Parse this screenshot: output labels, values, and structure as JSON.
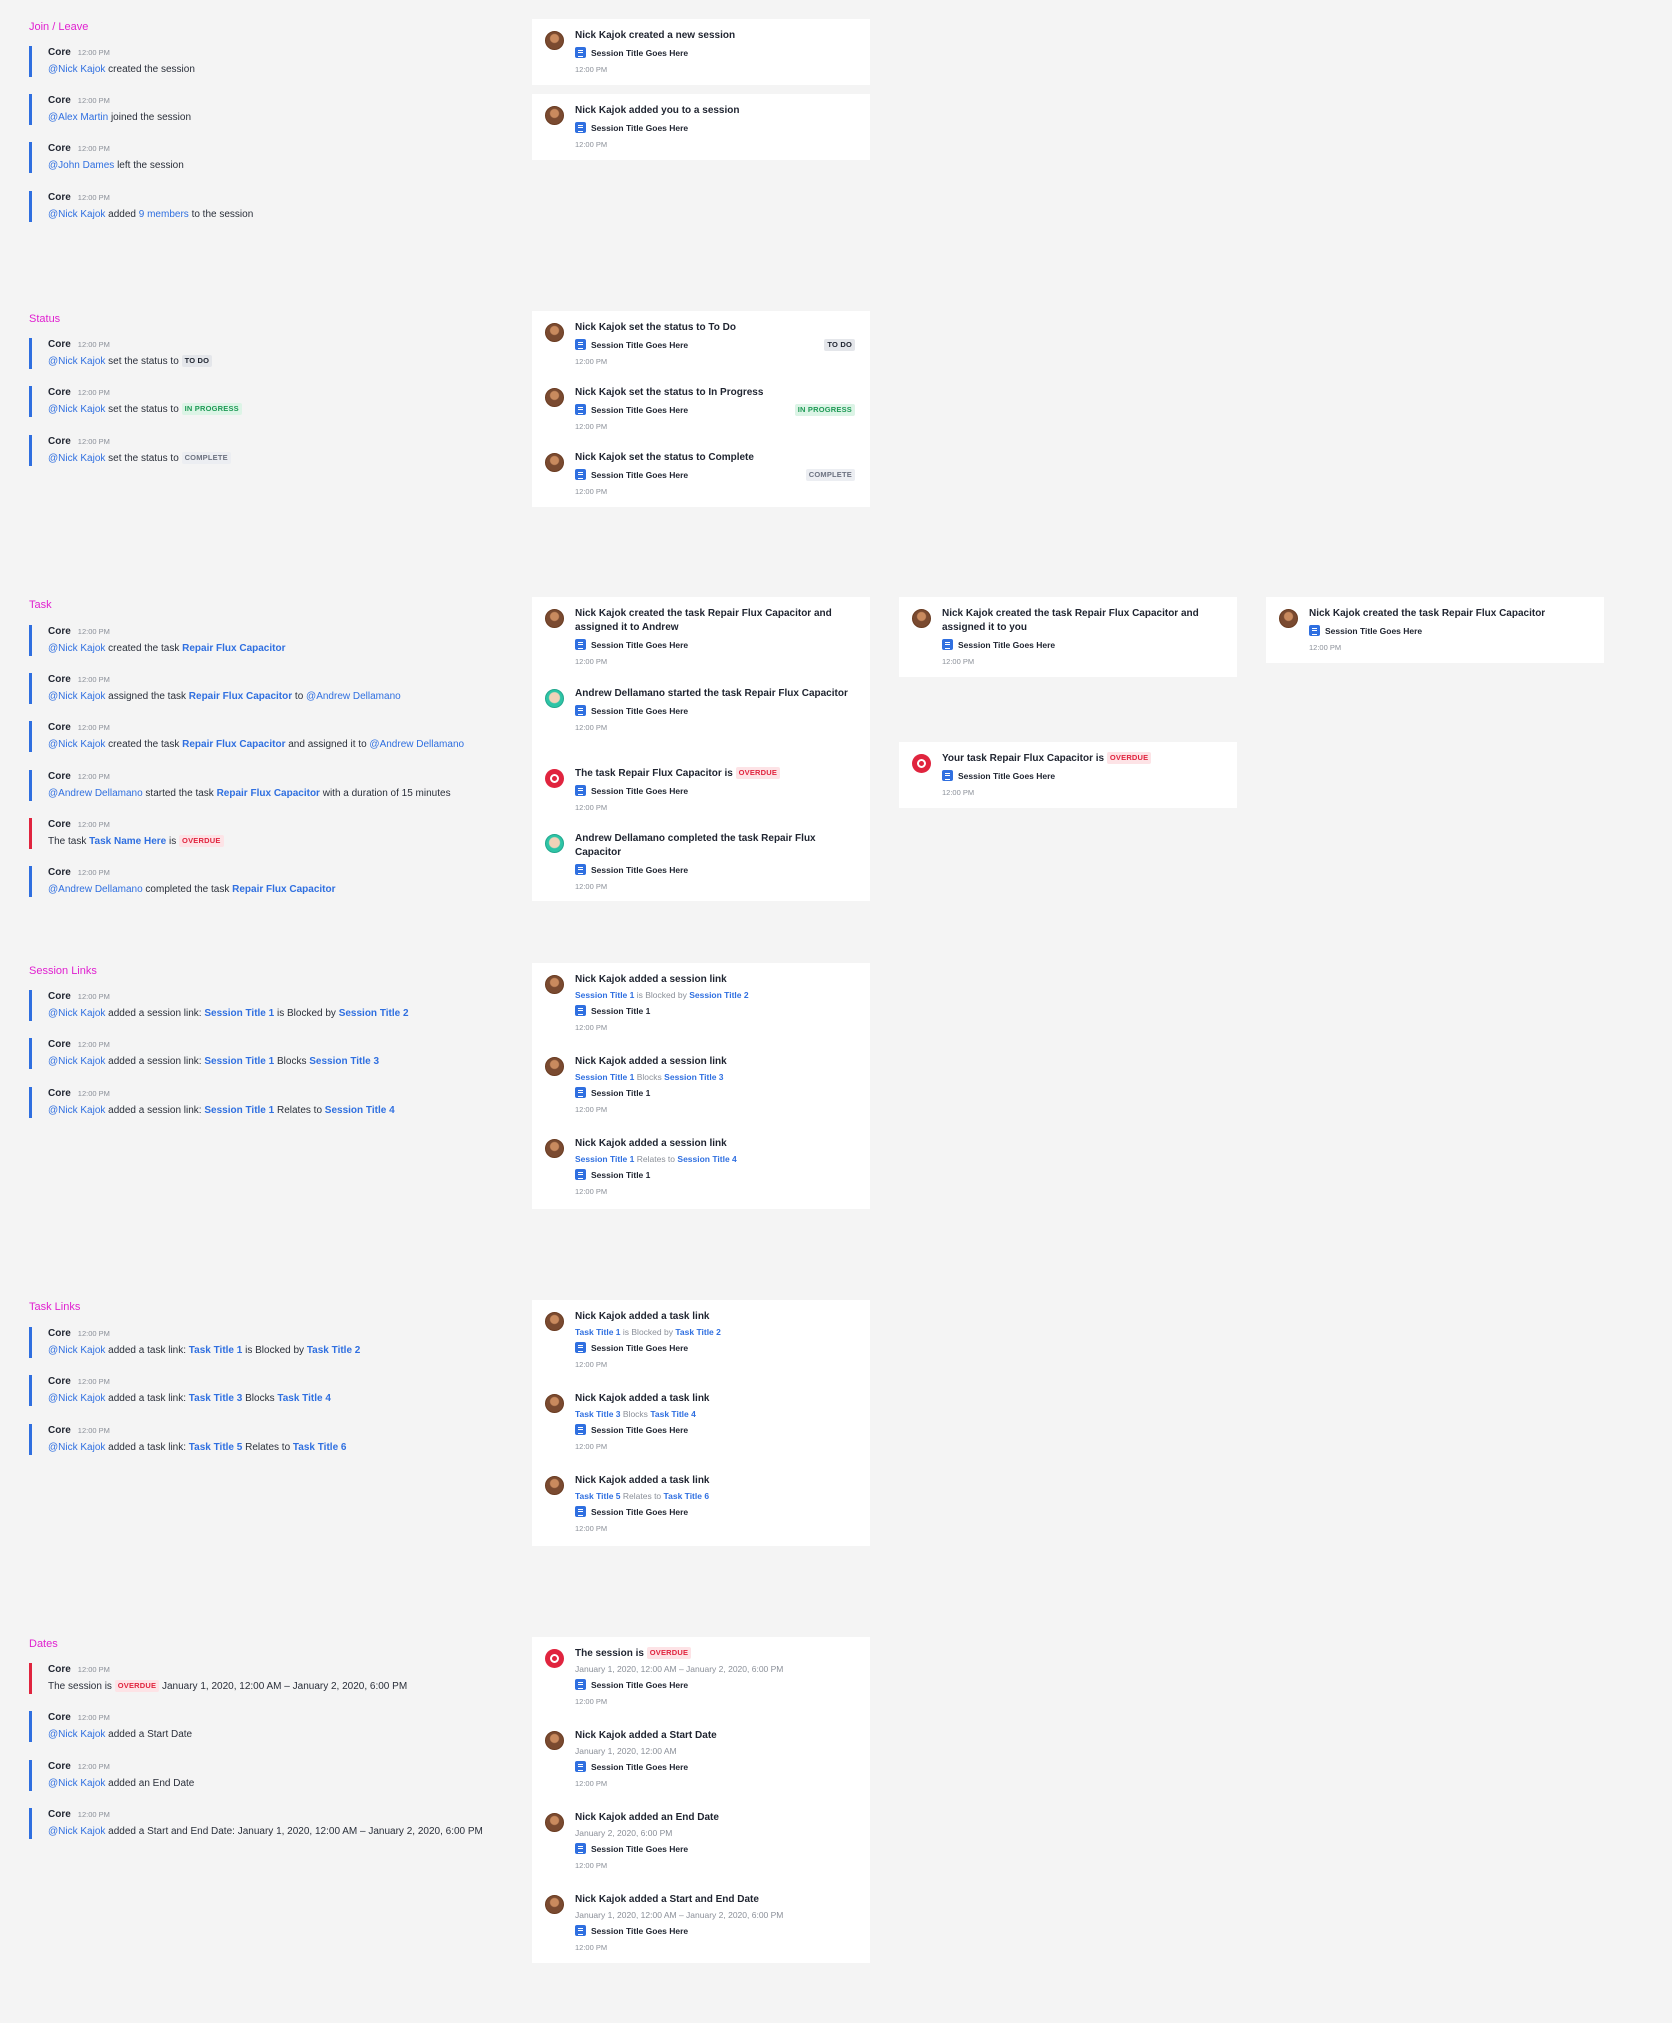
{
  "sections": [
    {
      "title": "Join / Leave"
    },
    {
      "title": "Status"
    },
    {
      "title": "Task"
    },
    {
      "title": "Session Links"
    },
    {
      "title": "Task Links"
    },
    {
      "title": "Dates"
    }
  ],
  "common": {
    "sender": "Core",
    "time": "12:00 PM",
    "session_title": "Session Title Goes Here",
    "session_title_1": "Session Title 1"
  },
  "names": {
    "nick": "@Nick Kajok",
    "alex": "@Alex Martin",
    "john": "@John Dames",
    "andrew": "@Andrew Dellamano"
  },
  "statuses": {
    "todo": "TO DO",
    "in_progress": "IN PROGRESS",
    "complete": "COMPLETE",
    "overdue": "OVERDUE"
  },
  "join_leave": {
    "created": "created the session",
    "joined": "joined the session",
    "left": "left the session",
    "added": "added",
    "members": "9 members",
    "to_session": "to the session",
    "n_created": "Nick Kajok created a new session",
    "n_added": "Nick Kajok added you to a session"
  },
  "status_msgs": {
    "set_status": "set the status to",
    "n_todo": "Nick Kajok set the status to To Do",
    "n_progress": "Nick Kajok set the status to In Progress",
    "n_complete": "Nick Kajok set the status to Complete"
  },
  "task": {
    "task_name": "Repair Flux Capacitor",
    "task_name_here": "Task Name Here",
    "created_the_task": "created the task",
    "assigned_the_task": "assigned the task",
    "to": "to",
    "and_assigned_it_to": "and assigned it to",
    "started_the_task": "started the task",
    "with_duration": "with a duration of 15 minutes",
    "the_task": "The task",
    "is": "is",
    "completed_the_task": "completed the task",
    "n_created_assigned": "Nick Kajok created the task Repair Flux Capacitor and assigned it to Andrew",
    "n_started": "Andrew Dellamano started the task Repair Flux Capacitor",
    "n_overdue_prefix": "The task Repair Flux Capacitor is",
    "n_completed": "Andrew Dellamano completed the task Repair Flux Capacitor",
    "n_created_assigned_you": "Nick Kajok created the task Repair Flux Capacitor and assigned it to you",
    "n_your_overdue_prefix": "Your task Repair Flux Capacitor is",
    "n_created_only": "Nick Kajok created the task Repair Flux Capacitor"
  },
  "session_links": {
    "added_session_link": "added a session link:",
    "title1": "Session Title 1",
    "title2": "Session Title 2",
    "title3": "Session Title 3",
    "title4": "Session Title 4",
    "is_blocked_by": "is Blocked by",
    "blocks": "Blocks",
    "relates_to": "Relates to",
    "n_added": "Nick Kajok added a session link"
  },
  "task_links": {
    "added_task_link": "added a task link:",
    "t1": "Task Title 1",
    "t2": "Task Title 2",
    "t3": "Task Title 3",
    "t4": "Task Title 4",
    "t5": "Task Title 5",
    "t6": "Task Title 6",
    "n_added": "Nick Kajok added a task link"
  },
  "dates": {
    "the_session_is": "The session is",
    "range": "January 1, 2020, 12:00 AM – January 2, 2020, 6:00 PM",
    "start": "January 1, 2020, 12:00 AM",
    "end": "January 2, 2020, 6:00 PM",
    "added_start": "added a Start Date",
    "added_end": "added an End Date",
    "added_start_end": "added a Start and End Date: January 1, 2020, 12:00 AM – January 2, 2020, 6:00 PM",
    "n_session_is": "The session is",
    "n_added_start": "Nick Kajok added a Start Date",
    "n_added_end": "Nick Kajok added an End Date",
    "n_added_start_end": "Nick Kajok added a Start and End Date"
  }
}
